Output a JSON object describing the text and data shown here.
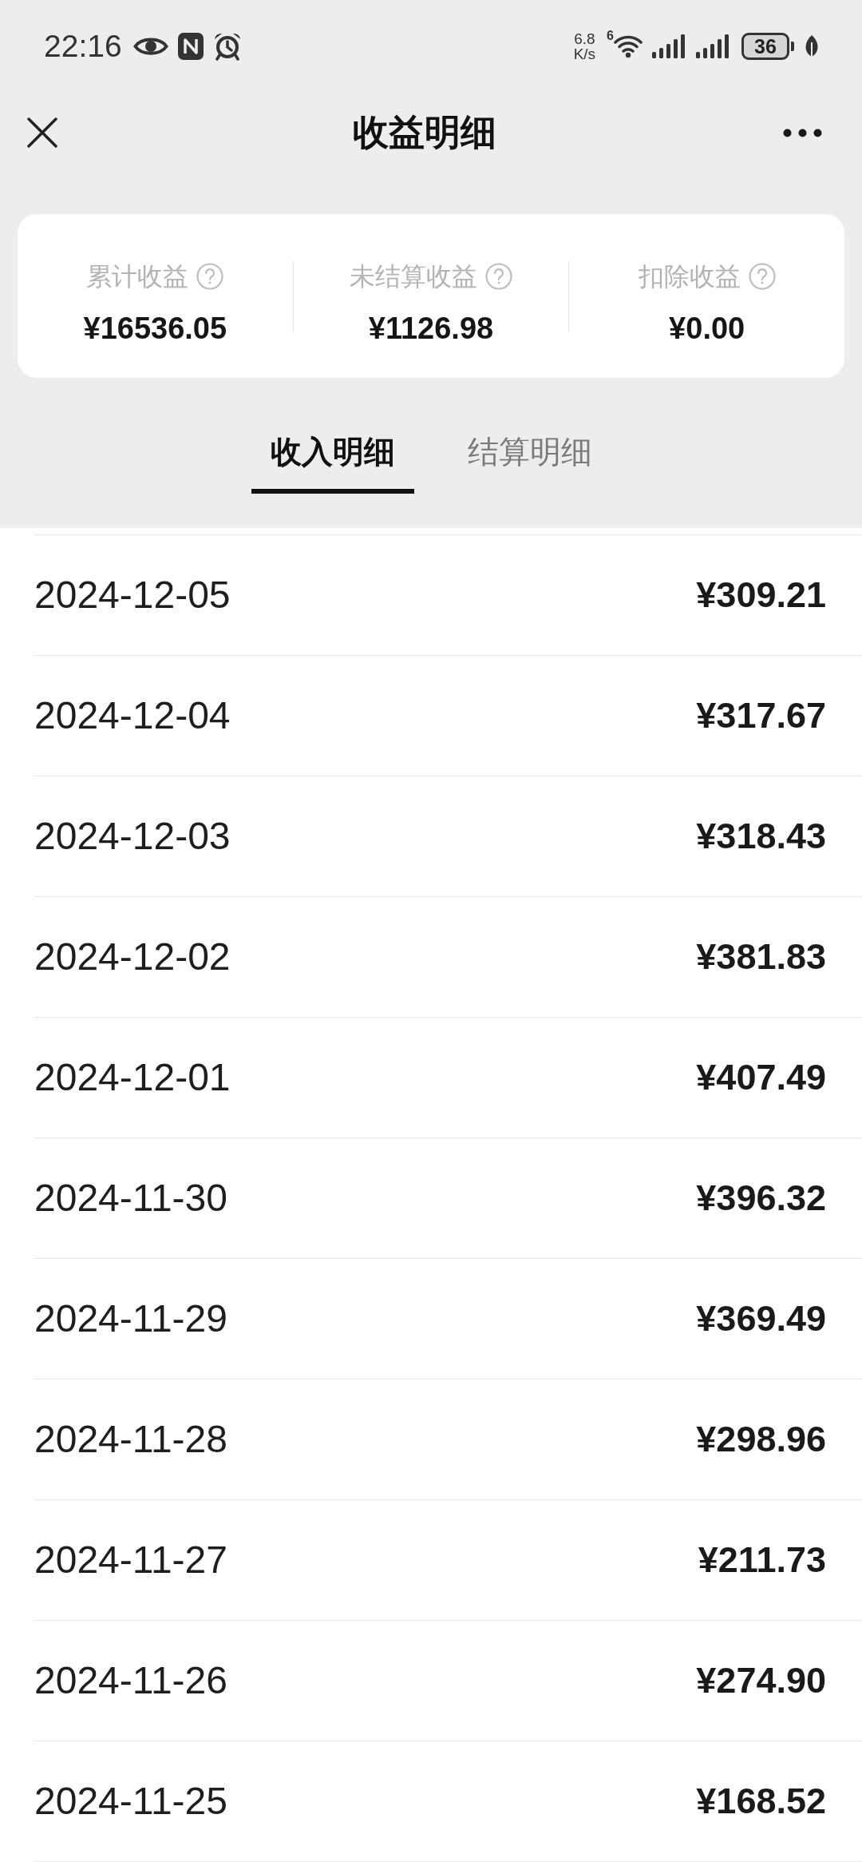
{
  "status_bar": {
    "time": "22:16",
    "net_speed": {
      "value": "6.8",
      "unit": "K/s"
    },
    "wifi_badge": "6",
    "battery": "36"
  },
  "header": {
    "title": "收益明细"
  },
  "summary": [
    {
      "label": "累计收益",
      "value": "¥16536.05"
    },
    {
      "label": "未结算收益",
      "value": "¥1126.98"
    },
    {
      "label": "扣除收益",
      "value": "¥0.00"
    }
  ],
  "tabs": [
    {
      "label": "收入明细",
      "selected": true
    },
    {
      "label": "结算明细",
      "selected": false
    }
  ],
  "rows": [
    {
      "date": "2024-12-05",
      "amount": "¥309.21"
    },
    {
      "date": "2024-12-04",
      "amount": "¥317.67"
    },
    {
      "date": "2024-12-03",
      "amount": "¥318.43"
    },
    {
      "date": "2024-12-02",
      "amount": "¥381.83"
    },
    {
      "date": "2024-12-01",
      "amount": "¥407.49"
    },
    {
      "date": "2024-11-30",
      "amount": "¥396.32"
    },
    {
      "date": "2024-11-29",
      "amount": "¥369.49"
    },
    {
      "date": "2024-11-28",
      "amount": "¥298.96"
    },
    {
      "date": "2024-11-27",
      "amount": "¥211.73"
    },
    {
      "date": "2024-11-26",
      "amount": "¥274.90"
    },
    {
      "date": "2024-11-25",
      "amount": "¥168.52"
    }
  ]
}
